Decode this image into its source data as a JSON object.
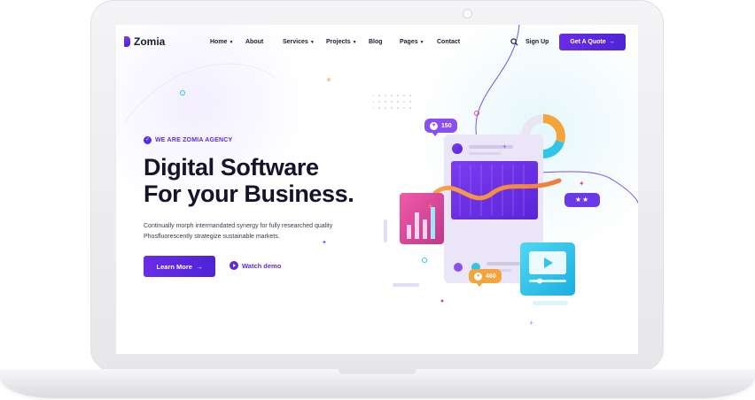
{
  "brand": {
    "name": "Zomia"
  },
  "nav": {
    "items": [
      {
        "label": "Home",
        "has_dropdown": true
      },
      {
        "label": "About",
        "has_dropdown": false
      },
      {
        "label": "Services",
        "has_dropdown": true
      },
      {
        "label": "Projects",
        "has_dropdown": true
      },
      {
        "label": "Blog",
        "has_dropdown": false
      },
      {
        "label": "Pages",
        "has_dropdown": true
      },
      {
        "label": "Contact",
        "has_dropdown": false
      }
    ],
    "signup_label": "Sign Up",
    "quote_label": "Get A Quote",
    "search_icon": "search-icon"
  },
  "hero": {
    "tag": "WE ARE ZOMIA AGENCY",
    "title_line1": "Digital Software",
    "title_line2": "For your Business.",
    "desc_line1": "Continually morph intermandated synergy for fully researched quality",
    "desc_line2": "Phosfluorescently strategize sustainable markets.",
    "learn_label": "Learn More",
    "watch_label": "Watch demo"
  },
  "illustration": {
    "likes": "150",
    "views": "460",
    "stars": "★★"
  },
  "colors": {
    "accent": "#5a2be0",
    "orange": "#f5a33b",
    "cyan": "#2ec5e8",
    "pink": "#e0479e"
  }
}
